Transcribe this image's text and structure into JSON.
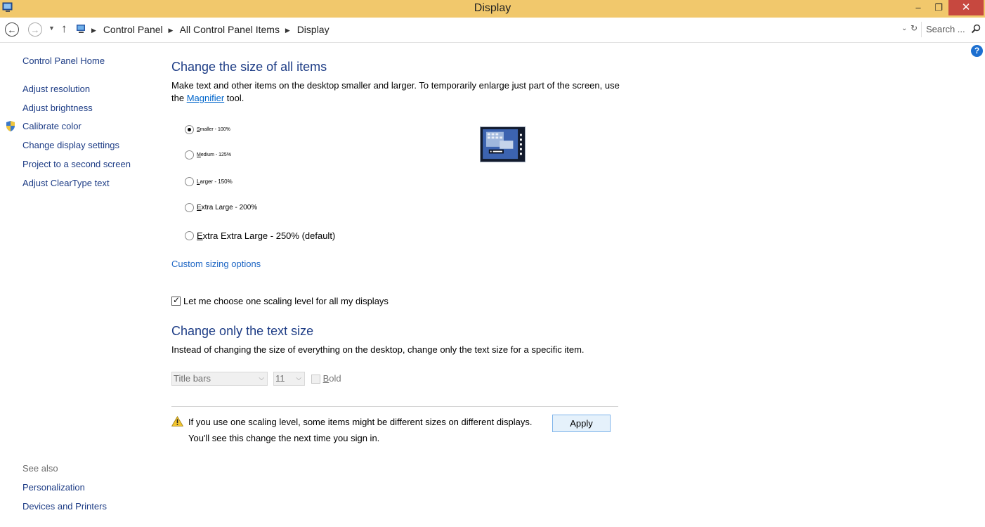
{
  "window": {
    "title": "Display",
    "minimize_glyph": "–",
    "maximize_glyph": "❐",
    "close_glyph": "✕"
  },
  "address_bar": {
    "breadcrumbs": [
      "Control Panel",
      "All Control Panel Items",
      "Display"
    ],
    "search_placeholder": "Search ..."
  },
  "sidebar": {
    "home": "Control Panel Home",
    "items": [
      "Adjust resolution",
      "Adjust brightness",
      "Calibrate color",
      "Change display settings",
      "Project to a second screen",
      "Adjust ClearType text"
    ],
    "see_also_label": "See also",
    "see_also_items": [
      "Personalization",
      "Devices and Printers"
    ]
  },
  "main": {
    "size_heading": "Change the size of all items",
    "size_desc_before": "Make text and other items on the desktop smaller and larger. To temporarily enlarge just part of the screen, use the ",
    "size_desc_link": "Magnifier",
    "size_desc_after": " tool.",
    "scale_options": [
      {
        "key": "S",
        "rest": "maller - 100%",
        "selected": true
      },
      {
        "key": "M",
        "rest": "edium - 125%",
        "selected": false
      },
      {
        "key": "L",
        "rest": "arger - 150%",
        "selected": false
      },
      {
        "key": "E",
        "rest": "xtra Large - 200%",
        "selected": false
      },
      {
        "key": "E",
        "rest": "xtra Extra Large - 250% (default)",
        "selected": false
      }
    ],
    "custom_link": "Custom sizing options",
    "one_scaling_label": "Let me choose one scaling level for all my displays",
    "one_scaling_checked": true,
    "text_heading": "Change only the text size",
    "text_desc": "Instead of changing the size of everything on the desktop, change only the text size for a specific item.",
    "item_select_value": "Title bars",
    "size_select_value": "11",
    "bold_key": "B",
    "bold_rest": "old",
    "warning_line1": "If you use one scaling level, some items might be different sizes on different displays.",
    "warning_line2": "You'll see this change the next time you sign in.",
    "apply_label": "Apply"
  },
  "colors": {
    "titlebar": "#f1c86c",
    "close_button": "#c7483f",
    "heading": "#1e3d86",
    "link": "#1e66c4"
  }
}
